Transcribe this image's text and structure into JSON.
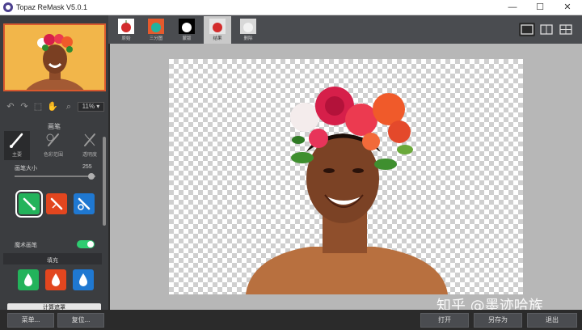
{
  "window": {
    "title": "Topaz ReMask V5.0.1",
    "minimize_glyph": "—",
    "maximize_glyph": "☐",
    "close_glyph": "✕"
  },
  "left": {
    "zoom": "11%",
    "brush_section_title": "画笔",
    "modes": [
      "主要",
      "色彩范围",
      "透明度"
    ],
    "brush_size_label": "画笔大小",
    "brush_size_value": "255",
    "brush_size_fraction": 0.95,
    "edge_aware_label": "魔术画笔",
    "edge_aware_on": true,
    "fill_section_title": "填充",
    "compute_label": "计算遮罩"
  },
  "tabs": [
    {
      "label": "原始",
      "icon": "apple-original-icon"
    },
    {
      "label": "三分图",
      "icon": "apple-trimap-icon"
    },
    {
      "label": "蒙版",
      "icon": "apple-mask-icon"
    },
    {
      "label": "结果",
      "icon": "apple-result-icon"
    },
    {
      "label": "删除",
      "icon": "delete-preview-icon"
    }
  ],
  "active_tab": "结果",
  "view_modes": [
    "single-view-icon",
    "split-view-icon",
    "quad-view-icon"
  ],
  "bottom": {
    "menu": "菜单...",
    "reset": "复位...",
    "open": "打开",
    "save_as": "另存为",
    "exit": "退出"
  },
  "watermark": "知乎 @墨迹哈族",
  "colors": {
    "keep_green": "#23b35b",
    "cut_red": "#e2461f",
    "compute_blue": "#1f78d1",
    "accent_orange": "#d9592e"
  }
}
